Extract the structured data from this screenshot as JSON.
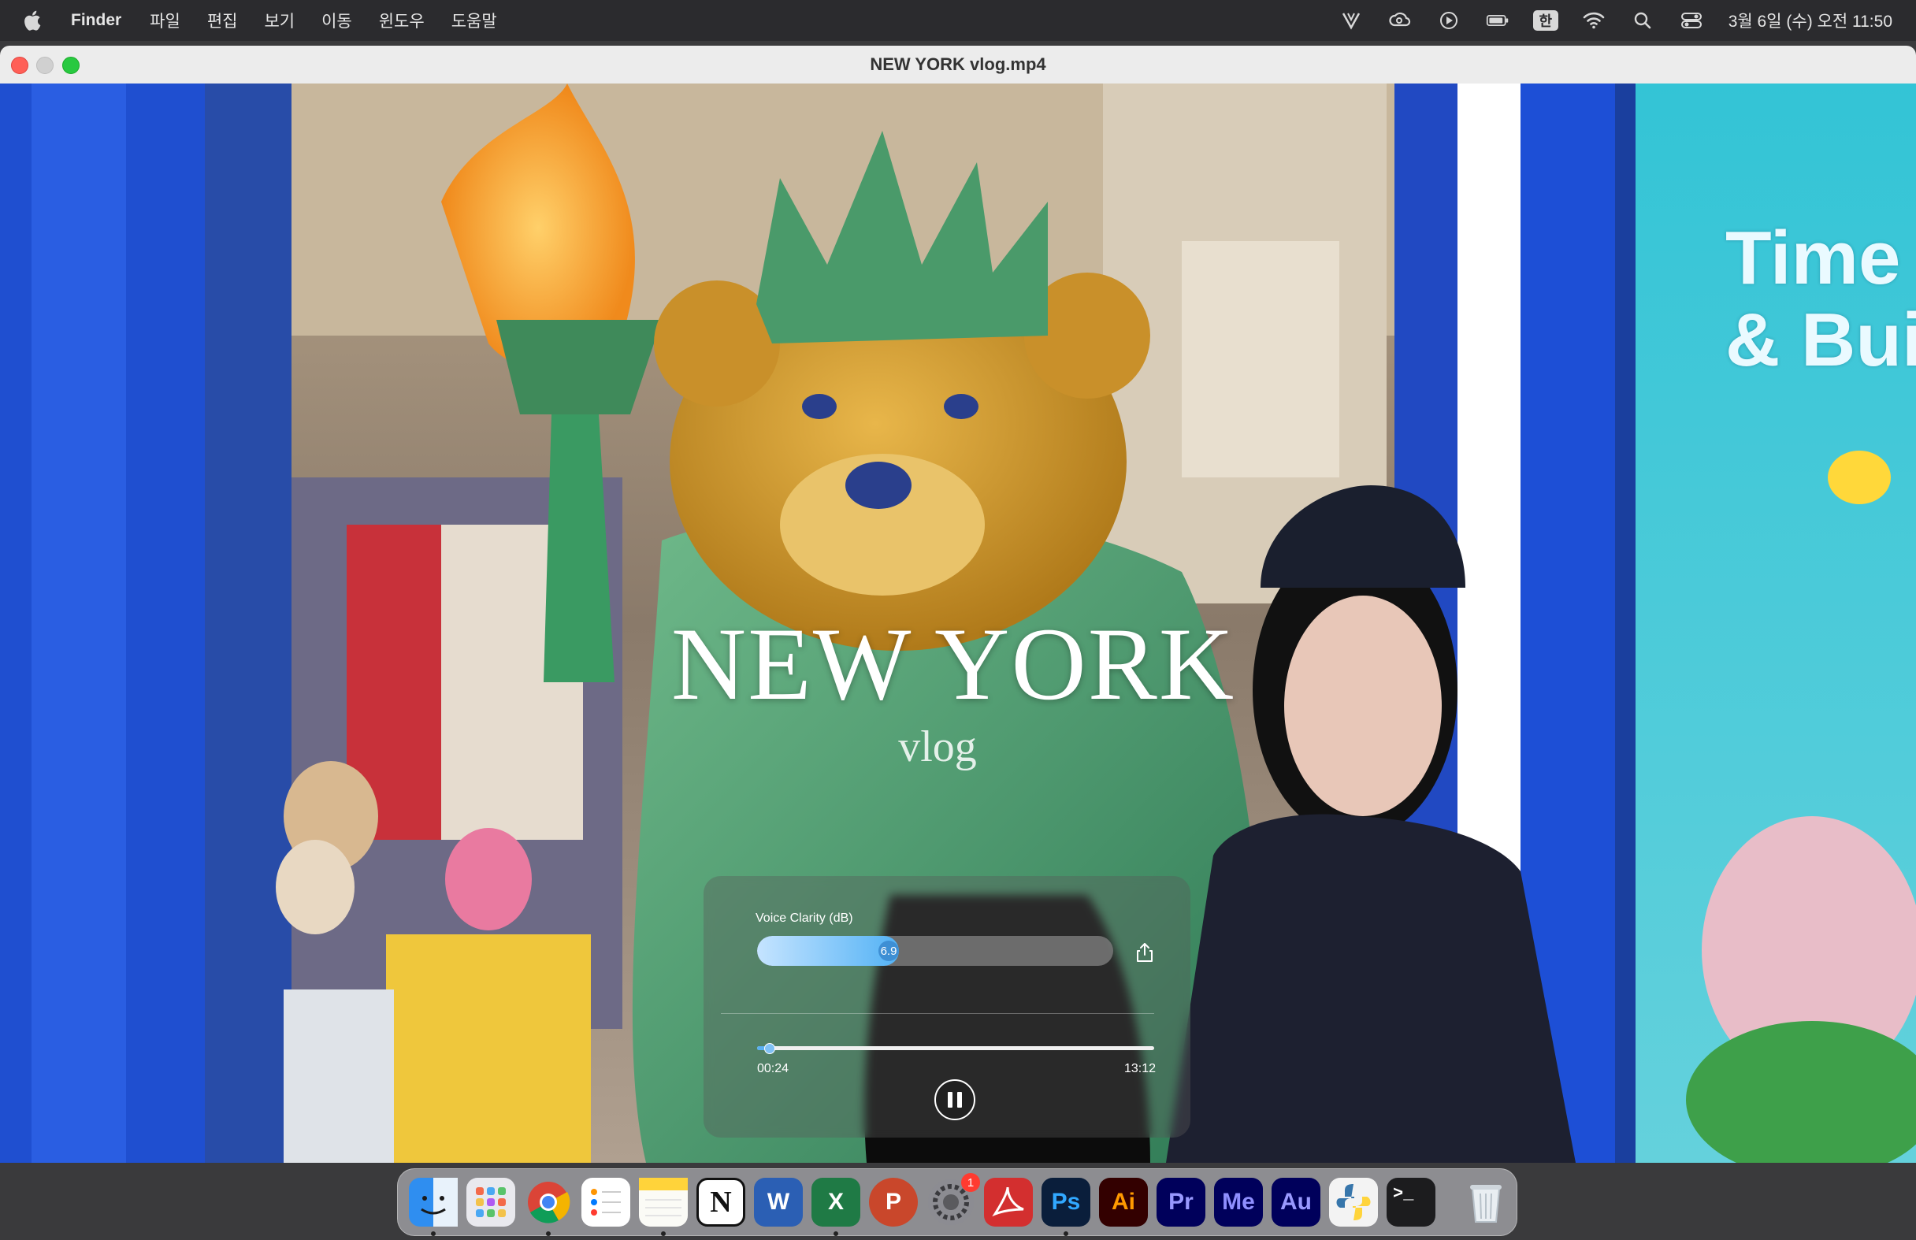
{
  "menubar": {
    "app_name": "Finder",
    "menus": [
      "파일",
      "편집",
      "보기",
      "이동",
      "윈도우",
      "도움말"
    ],
    "input_method": "한",
    "clock": "3월 6일 (수) 오전 11:50",
    "status_icons": [
      "vectorworks-icon",
      "creative-cloud-icon",
      "media-play-icon",
      "battery-icon",
      "input-method-icon",
      "wifi-icon",
      "search-icon",
      "control-center-icon"
    ]
  },
  "window": {
    "title": "NEW YORK vlog.mp4"
  },
  "video": {
    "title_text": "NEW YORK",
    "subtitle_text": "vlog",
    "sign_text": "Time & Bui"
  },
  "player": {
    "voice_clarity_label": "Voice Clarity (dB)",
    "voice_clarity_value": "6.9",
    "voice_clarity_fraction": 0.37,
    "elapsed": "00:24",
    "total": "13:12",
    "progress_fraction": 0.03,
    "state": "playing"
  },
  "dock": {
    "items": [
      {
        "name": "Finder",
        "icon": "finder-icon",
        "label": "",
        "color": "#2f8ef0",
        "text_color": "#ffffff",
        "running": true
      },
      {
        "name": "Launchpad",
        "icon": "launchpad-icon",
        "label": "",
        "color": "#e9e9ee",
        "text_color": "#333333",
        "running": false
      },
      {
        "name": "Google Chrome",
        "icon": "chrome-icon",
        "label": "",
        "color": "#ffffff",
        "text_color": "#333333",
        "running": true
      },
      {
        "name": "Reminders",
        "icon": "reminders-icon",
        "label": "",
        "color": "#ffffff",
        "text_color": "#333333",
        "running": false
      },
      {
        "name": "Notes",
        "icon": "notes-icon",
        "label": "",
        "color": "#fbfbf6",
        "text_color": "#333333",
        "running": true
      },
      {
        "name": "Notion",
        "icon": "notion-icon",
        "label": "N",
        "color": "#ffffff",
        "text_color": "#111111",
        "running": false
      },
      {
        "name": "Microsoft Word",
        "icon": "word-icon",
        "label": "W",
        "color": "#2b5fb4",
        "text_color": "#ffffff",
        "running": false
      },
      {
        "name": "Microsoft Excel",
        "icon": "excel-icon",
        "label": "X",
        "color": "#1f7a45",
        "text_color": "#ffffff",
        "running": true
      },
      {
        "name": "Microsoft PowerPoint",
        "icon": "powerpoint-icon",
        "label": "P",
        "color": "#ffffff",
        "text_color": "#c9472b",
        "running": false
      },
      {
        "name": "System Settings",
        "icon": "settings-gear-icon",
        "label": "",
        "color": "#8c8c92",
        "text_color": "#333333",
        "running": false,
        "badge": "1"
      },
      {
        "name": "Adobe Acrobat",
        "icon": "acrobat-icon",
        "label": "",
        "color": "#d32f2f",
        "text_color": "#ffffff",
        "running": false
      },
      {
        "name": "Adobe Photoshop",
        "icon": "photoshop-icon",
        "label": "Ps",
        "color": "#0a1e3b",
        "text_color": "#31a8ff",
        "running": true
      },
      {
        "name": "Adobe Illustrator",
        "icon": "illustrator-icon",
        "label": "Ai",
        "color": "#330000",
        "text_color": "#ff9a00",
        "running": false
      },
      {
        "name": "Adobe Premiere Pro",
        "icon": "premiere-icon",
        "label": "Pr",
        "color": "#00005b",
        "text_color": "#9999ff",
        "running": false
      },
      {
        "name": "Adobe Media Encoder",
        "icon": "media-encoder-icon",
        "label": "Me",
        "color": "#00005b",
        "text_color": "#8f8fff",
        "running": false
      },
      {
        "name": "Adobe Audition",
        "icon": "audition-icon",
        "label": "Au",
        "color": "#00005b",
        "text_color": "#9999ff",
        "running": false
      },
      {
        "name": "Python Launcher",
        "icon": "python-icon",
        "label": "",
        "color": "#f3f3f3",
        "text_color": "#333333",
        "running": false
      },
      {
        "name": "Terminal",
        "icon": "terminal-icon",
        "label": ">_",
        "color": "#1c1c1e",
        "text_color": "#ffffff",
        "running": false
      }
    ],
    "trash": {
      "name": "Trash",
      "icon": "trash-icon"
    }
  }
}
